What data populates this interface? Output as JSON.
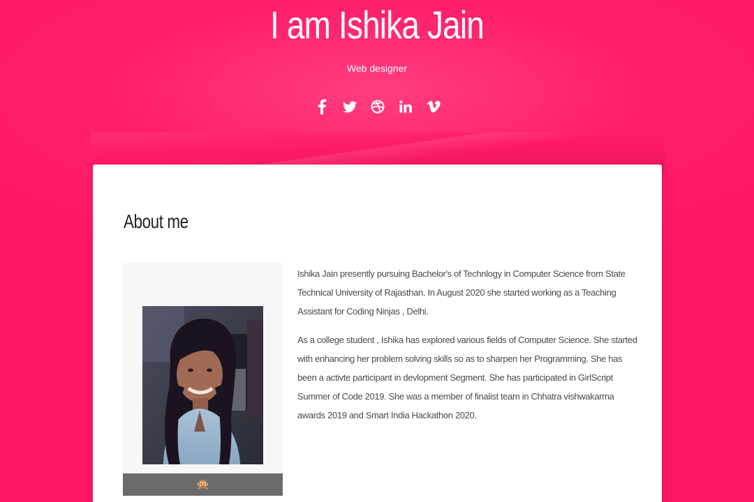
{
  "hero": {
    "title": "I am Ishika Jain",
    "subtitle": "Web designer"
  },
  "social": [
    {
      "name": "facebook-icon"
    },
    {
      "name": "twitter-icon"
    },
    {
      "name": "dribbble-icon"
    },
    {
      "name": "linkedin-icon"
    },
    {
      "name": "vimeo-icon"
    }
  ],
  "about": {
    "title": "About me",
    "caption_emoji": "🙊",
    "paragraphs": [
      "Ishika Jain presently pursuing Bachelor's of Technlogy in Computer Science from State Technical University of Rajasthan. In August 2020 she started working as a Teaching Assistant for Coding Ninjas , Delhi.",
      "As a college student , Ishika has explored various fields of Computer Science. She started with enhancing her problem solving skills so as to sharpen her Programming. She has been a activte participant in devlopment Segment. She has participated in GirlScript Summer of Code 2019. She was a member of finalist team in Chhatra vishwakarma awards 2019 and Smart India Hackathon 2020."
    ]
  },
  "colors": {
    "accent": "#ff1f6c",
    "card": "#ffffff",
    "caption_bar": "#6b6b6b"
  }
}
